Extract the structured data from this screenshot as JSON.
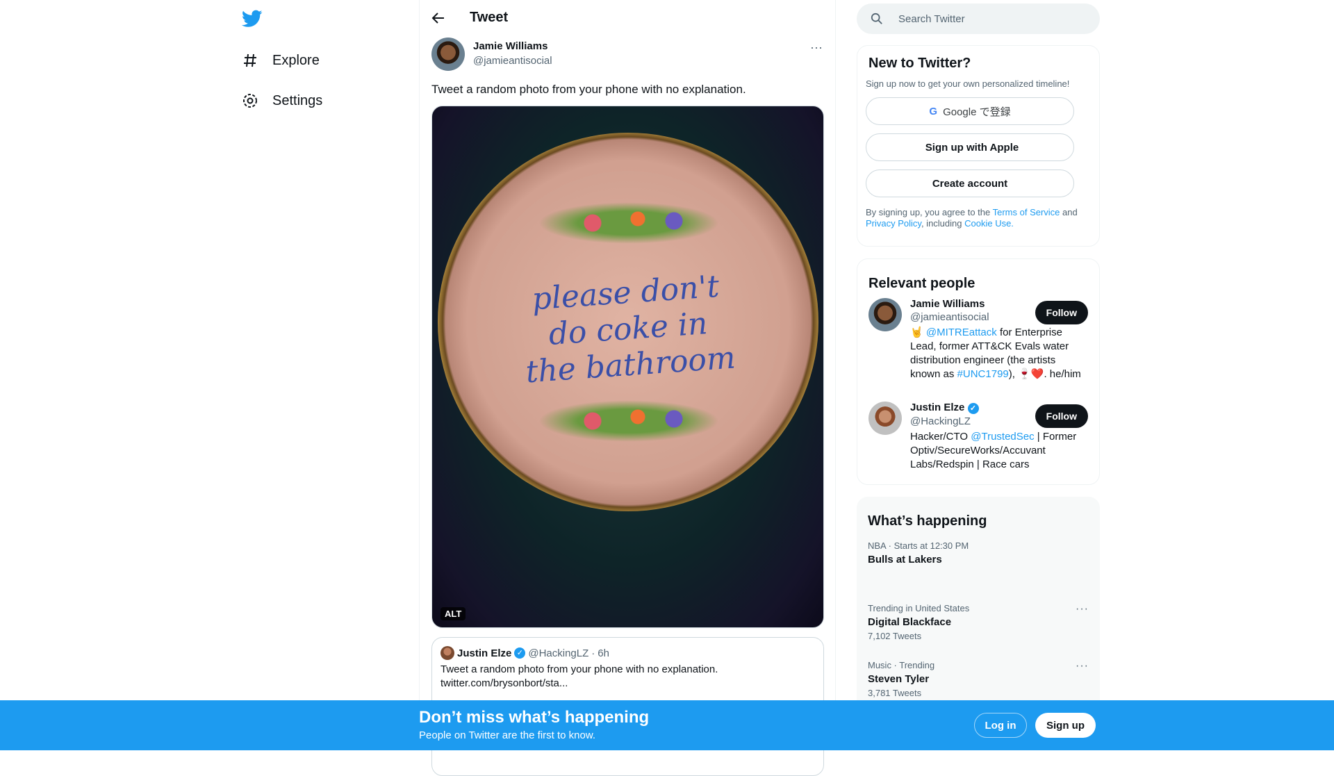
{
  "nav": {
    "explore": "Explore",
    "settings": "Settings"
  },
  "header": {
    "title": "Tweet"
  },
  "tweet": {
    "author_name": "Jamie Williams",
    "author_handle": "@jamieantisocial",
    "text": "Tweet a random photo from your phone with no explanation.",
    "photo_text": [
      "please don't",
      "do coke in",
      "the bathroom"
    ],
    "alt_badge": "ALT",
    "quote": {
      "name": "Justin Elze",
      "handle": "@HackingLZ",
      "sep": "·",
      "time": "6h",
      "text": "Tweet a random photo from your phone with no explanation.",
      "link": "twitter.com/brysonbort/sta..."
    }
  },
  "search": {
    "placeholder": "Search Twitter"
  },
  "signup": {
    "title": "New to Twitter?",
    "subtitle": "Sign up now to get your own personalized timeline!",
    "google": "Google で登録",
    "apple": "Sign up with Apple",
    "create": "Create account",
    "legal_1": "By signing up, you agree to the ",
    "terms": "Terms of Service",
    "legal_2": " and ",
    "privacy": "Privacy Policy",
    "legal_3": ", including ",
    "cookie": "Cookie Use."
  },
  "relevant": {
    "title": "Relevant people",
    "people": [
      {
        "name": "Jamie Williams",
        "handle": "@jamieantisocial",
        "follow": "Follow",
        "bio": [
          {
            "t": "🤘 "
          },
          {
            "t": "@MITREattack",
            "link": true
          },
          {
            "t": " for Enterprise Lead, former ATT&CK Evals water distribution engineer (the artists known as "
          },
          {
            "t": "#UNC1799",
            "link": true
          },
          {
            "t": "), 🍷❤️. he/him"
          }
        ]
      },
      {
        "name": "Justin Elze",
        "handle": "@HackingLZ",
        "follow": "Follow",
        "verified": true,
        "bio": [
          {
            "t": "Hacker/CTO "
          },
          {
            "t": "@TrustedSec",
            "link": true
          },
          {
            "t": " | Former Optiv/SecureWorks/Accuvant Labs/Redspin | Race cars"
          }
        ]
      }
    ]
  },
  "happening": {
    "title": "What’s happening",
    "trends": [
      {
        "meta": "NBA · Starts at 12:30 PM",
        "title": "Bulls at Lakers",
        "count": ""
      },
      {
        "meta": "Trending in United States",
        "title": "Digital Blackface",
        "count": "7,102 Tweets"
      },
      {
        "meta": "Music · Trending",
        "title": "Steven Tyler",
        "count": "3,781 Tweets"
      }
    ]
  },
  "banner": {
    "title": "Don’t miss what’s happening",
    "subtitle": "People on Twitter are the first to know.",
    "login": "Log in",
    "signup": "Sign up"
  },
  "colors": {
    "accent": "#1d9bf0",
    "text": "#0f1419",
    "muted": "#536471"
  }
}
